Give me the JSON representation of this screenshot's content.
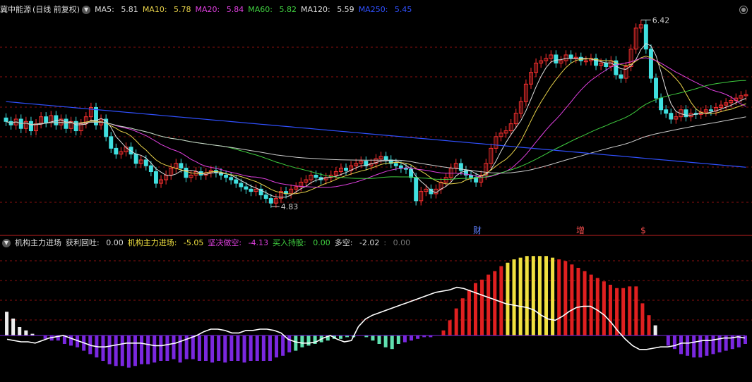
{
  "main_header": {
    "title": "冀中能源",
    "mode": "(日线 前复权)",
    "ma": [
      {
        "label": "MA5:",
        "value": "5.81",
        "color": "#dddddd"
      },
      {
        "label": "MA10:",
        "value": "5.78",
        "color": "#e8d24a"
      },
      {
        "label": "MA20:",
        "value": "5.84",
        "color": "#e040e0"
      },
      {
        "label": "MA60:",
        "value": "5.82",
        "color": "#40d040"
      },
      {
        "label": "MA120:",
        "value": "5.59",
        "color": "#dddddd"
      },
      {
        "label": "MA250:",
        "value": "5.45",
        "color": "#3050ff"
      }
    ]
  },
  "sub_header": {
    "title": "机构主力进场",
    "items": [
      {
        "label": "获利回吐:",
        "value": "0.00",
        "color": "#dddddd"
      },
      {
        "label": "机构主力进场:",
        "value": "-5.05",
        "color": "#f0e040"
      },
      {
        "label": "坚决做空:",
        "value": "-4.13",
        "color": "#e040e0"
      },
      {
        "label": "买入持股:",
        "value": "0.00",
        "color": "#40d040"
      },
      {
        "label": "多空:",
        "value": "-2.02",
        "color": "#dddddd"
      },
      {
        "label": ":",
        "value": "0.00",
        "color": "#777777"
      }
    ]
  },
  "annotations": {
    "high": "6.42",
    "low": "4.83",
    "marker_cai": "财",
    "marker_zeng": "增",
    "marker_s": "$"
  },
  "colors": {
    "up": "#ff3030",
    "down": "#40e0e0",
    "grid": "#8a1010"
  },
  "chart_data": {
    "type": "candlestick",
    "price_range": [
      4.7,
      6.5
    ],
    "closes": [
      5.58,
      5.55,
      5.6,
      5.52,
      5.58,
      5.5,
      5.56,
      5.62,
      5.57,
      5.63,
      5.55,
      5.6,
      5.52,
      5.58,
      5.5,
      5.56,
      5.62,
      5.7,
      5.55,
      5.6,
      5.45,
      5.35,
      5.3,
      5.32,
      5.36,
      5.3,
      5.22,
      5.25,
      5.2,
      5.15,
      5.05,
      5.08,
      5.12,
      5.18,
      5.22,
      5.18,
      5.1,
      5.12,
      5.15,
      5.12,
      5.14,
      5.16,
      5.14,
      5.12,
      5.1,
      5.08,
      5.05,
      5.02,
      5,
      4.98,
      5,
      4.95,
      4.92,
      4.88,
      4.92,
      4.98,
      4.96,
      5,
      5.02,
      5.06,
      5.08,
      5.12,
      5.1,
      5.08,
      5.1,
      5.12,
      5.15,
      5.18,
      5.16,
      5.2,
      5.22,
      5.24,
      5.2,
      5.22,
      5.26,
      5.28,
      5.25,
      5.22,
      5.2,
      5.18,
      5.17,
      5.1,
      4.9,
      4.98,
      5,
      4.96,
      5,
      5.06,
      5.1,
      5.18,
      5.22,
      5.16,
      5.12,
      5.1,
      5.06,
      5.12,
      5.22,
      5.35,
      5.45,
      5.48,
      5.5,
      5.56,
      5.65,
      5.75,
      5.9,
      6,
      6.08,
      6.1,
      6.12,
      6.15,
      6.08,
      6.1,
      6.15,
      6.12,
      6.13,
      6.1,
      6.1,
      6.12,
      6.06,
      6.08,
      6.05,
      6.1,
      5.98,
      5.95,
      6.05,
      6.2,
      6.38,
      6.41,
      6.2,
      5.95,
      5.78,
      5.68,
      5.65,
      5.6,
      5.62,
      5.68,
      5.62,
      5.65,
      5.64,
      5.66,
      5.68,
      5.67,
      5.7,
      5.72,
      5.74,
      5.76,
      5.78,
      5.8,
      5.81
    ],
    "indicator": {
      "type": "bar",
      "values": [
        1.4,
        1,
        0.5,
        0.3,
        0.1,
        0,
        -0.2,
        -0.3,
        -0.3,
        -0.5,
        -0.6,
        -0.7,
        -0.9,
        -1.1,
        -1.3,
        -1.5,
        -1.7,
        -1.8,
        -1.8,
        -1.9,
        -1.8,
        -1.7,
        -1.7,
        -1.6,
        -1.5,
        -1.5,
        -1.4,
        -1.6,
        -1.4,
        -1.4,
        -1.5,
        -1.5,
        -1.6,
        -1.5,
        -1.6,
        -1.5,
        -1.5,
        -1.6,
        -1.5,
        -1.5,
        -1.5,
        -1.5,
        -1.3,
        -1.2,
        -1,
        -0.9,
        -0.7,
        -0.6,
        -0.5,
        -0.4,
        -0.3,
        -0.2,
        -0.2,
        -0.1,
        -0.1,
        0,
        -0.1,
        -0.3,
        -0.5,
        -0.7,
        -0.8,
        -0.5,
        -0.4,
        -0.3,
        -0.2,
        -0.1,
        -0.1,
        0,
        0.3,
        0.9,
        1.6,
        2.2,
        2.7,
        3.1,
        3.3,
        3.6,
        3.8,
        4.1,
        4.3,
        4.5,
        4.6,
        4.7,
        4.7,
        4.7,
        4.7,
        4.6,
        4.5,
        4.4,
        4.2,
        4,
        3.8,
        3.6,
        3.4,
        3.2,
        3,
        2.8,
        2.8,
        2.9,
        2.9,
        1.9,
        1.2,
        0.6,
        0,
        -0.6,
        -0.8,
        -1.1,
        -1.2,
        -1.3,
        -1.3,
        -1.2,
        -1.1,
        -1,
        -0.9,
        -0.8,
        -0.7,
        -0.5
      ],
      "line": [
        -0.3,
        -0.4,
        -0.5,
        -0.5,
        -0.6,
        -0.4,
        -0.2,
        -0.1,
        0,
        -0.2,
        -0.4,
        -0.6,
        -0.8,
        -0.9,
        -0.9,
        -0.8,
        -0.7,
        -0.6,
        -0.6,
        -0.6,
        -0.7,
        -0.8,
        -0.8,
        -0.7,
        -0.6,
        -0.4,
        -0.2,
        0,
        0.3,
        0.5,
        0.5,
        0.4,
        0.2,
        0.2,
        0.4,
        0.4,
        0.5,
        0.5,
        0.4,
        0.2,
        -0.3,
        -0.5,
        -0.6,
        -0.6,
        -0.5,
        -0.2,
        0,
        -0.3,
        -0.5,
        -0.4,
        0.7,
        1.3,
        1.6,
        1.8,
        2,
        2.2,
        2.4,
        2.6,
        2.8,
        3,
        3.2,
        3.4,
        3.5,
        3.6,
        3.8,
        3.7,
        3.5,
        3.3,
        3.1,
        2.9,
        2.7,
        2.5,
        2.4,
        2.3,
        2.2,
        2,
        1.6,
        1.3,
        1.2,
        1.5,
        1.9,
        2.2,
        2.3,
        2.3,
        2,
        1.6,
        1,
        0.3,
        -0.3,
        -0.8,
        -1.1,
        -1.1,
        -1,
        -0.9,
        -0.9,
        -0.8,
        -0.6,
        -0.6,
        -0.5,
        -0.4,
        -0.4,
        -0.3,
        -0.2,
        -0.2,
        -0.1,
        -0.2
      ]
    }
  }
}
